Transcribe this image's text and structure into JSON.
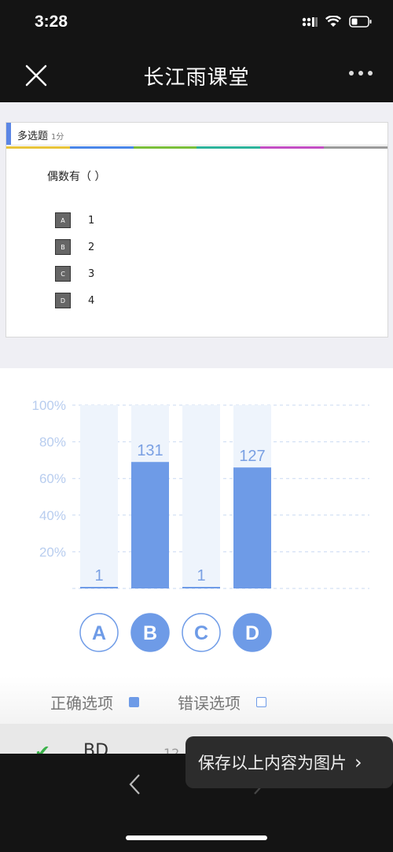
{
  "status_bar": {
    "time": "3:28"
  },
  "nav": {
    "title": "长江雨课堂"
  },
  "question": {
    "type": "多选题",
    "score": "1分",
    "stem": "偶数有（ ）",
    "options": [
      {
        "letter": "A",
        "text": "1"
      },
      {
        "letter": "B",
        "text": "2"
      },
      {
        "letter": "C",
        "text": "3"
      },
      {
        "letter": "D",
        "text": "4"
      }
    ]
  },
  "chart_data": {
    "type": "bar",
    "categories": [
      "A",
      "B",
      "C",
      "D"
    ],
    "values": [
      1,
      131,
      1,
      127
    ],
    "percent": [
      0.5,
      69,
      0.5,
      66
    ],
    "correct": [
      false,
      true,
      false,
      true
    ],
    "ytick_labels": [
      "100%",
      "80%",
      "60%",
      "40%",
      "20%"
    ],
    "ylim": [
      0,
      100
    ],
    "grid": true,
    "colors": {
      "correct": "#6e9be7",
      "track": "#eef4fc",
      "axis": "#c9d9f2",
      "tick": "#b8cdef",
      "label": "#7aa0e3"
    }
  },
  "legend": {
    "correct_label": "正确选项",
    "wrong_label": "错误选项"
  },
  "answer_row": {
    "answer": "BD",
    "count": "12"
  },
  "toast": {
    "label": "保存以上内容为图片",
    "chevron": "›"
  }
}
